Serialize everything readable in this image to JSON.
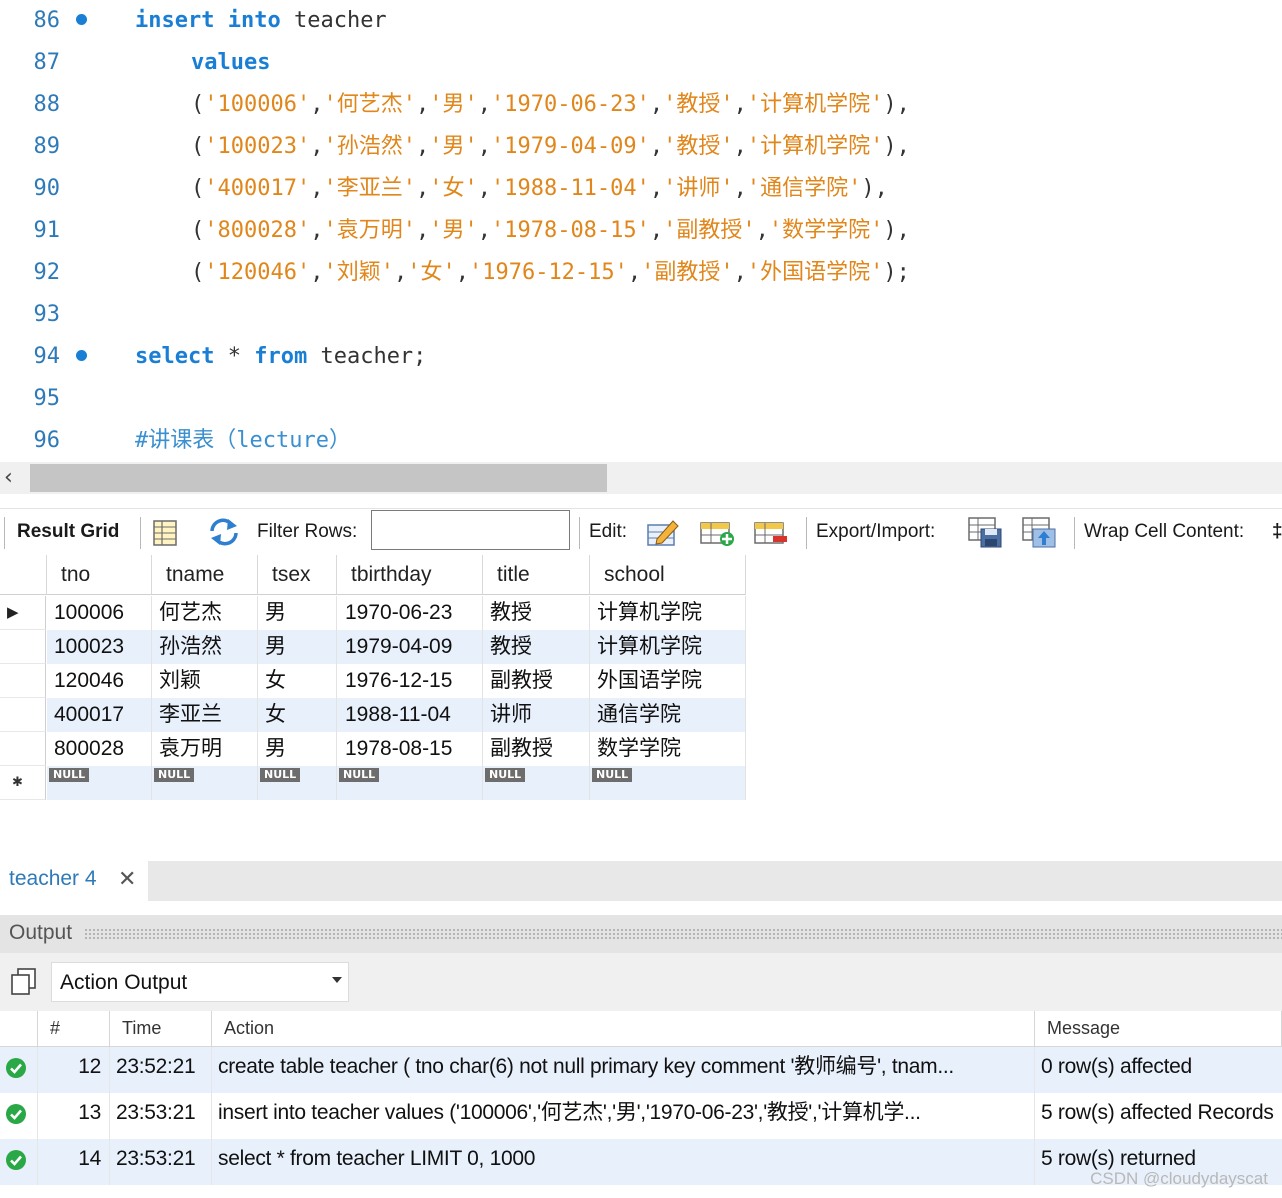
{
  "editor": {
    "lines": [
      {
        "num": "86",
        "marker": true,
        "tokens": [
          [
            "kw",
            "insert"
          ],
          [
            "id",
            " "
          ],
          [
            "kw",
            "into"
          ],
          [
            "id",
            " teacher"
          ]
        ],
        "indent": 0
      },
      {
        "num": "87",
        "marker": false,
        "tokens": [
          [
            "kw",
            "values"
          ]
        ],
        "indent": 1
      },
      {
        "num": "88",
        "marker": false,
        "tokens": [
          [
            "pun",
            "("
          ],
          [
            "str",
            "'100006'"
          ],
          [
            "pun",
            ","
          ],
          [
            "str",
            "'何艺杰'"
          ],
          [
            "pun",
            ","
          ],
          [
            "str",
            "'男'"
          ],
          [
            "pun",
            ","
          ],
          [
            "str",
            "'1970-06-23'"
          ],
          [
            "pun",
            ","
          ],
          [
            "str",
            "'教授'"
          ],
          [
            "pun",
            ","
          ],
          [
            "str",
            "'计算机学院'"
          ],
          [
            "pun",
            "),"
          ]
        ],
        "indent": 1
      },
      {
        "num": "89",
        "marker": false,
        "tokens": [
          [
            "pun",
            "("
          ],
          [
            "str",
            "'100023'"
          ],
          [
            "pun",
            ","
          ],
          [
            "str",
            "'孙浩然'"
          ],
          [
            "pun",
            ","
          ],
          [
            "str",
            "'男'"
          ],
          [
            "pun",
            ","
          ],
          [
            "str",
            "'1979-04-09'"
          ],
          [
            "pun",
            ","
          ],
          [
            "str",
            "'教授'"
          ],
          [
            "pun",
            ","
          ],
          [
            "str",
            "'计算机学院'"
          ],
          [
            "pun",
            "),"
          ]
        ],
        "indent": 1
      },
      {
        "num": "90",
        "marker": false,
        "tokens": [
          [
            "pun",
            "("
          ],
          [
            "str",
            "'400017'"
          ],
          [
            "pun",
            ","
          ],
          [
            "str",
            "'李亚兰'"
          ],
          [
            "pun",
            ","
          ],
          [
            "str",
            "'女'"
          ],
          [
            "pun",
            ","
          ],
          [
            "str",
            "'1988-11-04'"
          ],
          [
            "pun",
            ","
          ],
          [
            "str",
            "'讲师'"
          ],
          [
            "pun",
            ","
          ],
          [
            "str",
            "'通信学院'"
          ],
          [
            "pun",
            "),"
          ]
        ],
        "indent": 1
      },
      {
        "num": "91",
        "marker": false,
        "tokens": [
          [
            "pun",
            "("
          ],
          [
            "str",
            "'800028'"
          ],
          [
            "pun",
            ","
          ],
          [
            "str",
            "'袁万明'"
          ],
          [
            "pun",
            ","
          ],
          [
            "str",
            "'男'"
          ],
          [
            "pun",
            ","
          ],
          [
            "str",
            "'1978-08-15'"
          ],
          [
            "pun",
            ","
          ],
          [
            "str",
            "'副教授'"
          ],
          [
            "pun",
            ","
          ],
          [
            "str",
            "'数学学院'"
          ],
          [
            "pun",
            "),"
          ]
        ],
        "indent": 1
      },
      {
        "num": "92",
        "marker": false,
        "tokens": [
          [
            "pun",
            "("
          ],
          [
            "str",
            "'120046'"
          ],
          [
            "pun",
            ","
          ],
          [
            "str",
            "'刘颖'"
          ],
          [
            "pun",
            ","
          ],
          [
            "str",
            "'女'"
          ],
          [
            "pun",
            ","
          ],
          [
            "str",
            "'1976-12-15'"
          ],
          [
            "pun",
            ","
          ],
          [
            "str",
            "'副教授'"
          ],
          [
            "pun",
            ","
          ],
          [
            "str",
            "'外国语学院'"
          ],
          [
            "pun",
            ");"
          ]
        ],
        "indent": 1
      },
      {
        "num": "93",
        "marker": false,
        "tokens": [],
        "indent": 0
      },
      {
        "num": "94",
        "marker": true,
        "tokens": [
          [
            "kw",
            "select"
          ],
          [
            "id",
            " * "
          ],
          [
            "kw",
            "from"
          ],
          [
            "id",
            " teacher;"
          ]
        ],
        "indent": 0
      },
      {
        "num": "95",
        "marker": false,
        "tokens": [],
        "indent": 0
      },
      {
        "num": "96",
        "marker": false,
        "tokens": [
          [
            "cmt",
            "#讲课表（lecture）"
          ]
        ],
        "indent": 0
      }
    ]
  },
  "result_toolbar": {
    "result_grid_label": "Result Grid",
    "filter_rows_label": "Filter Rows:",
    "filter_rows_value": "",
    "edit_label": "Edit:",
    "export_import_label": "Export/Import:",
    "wrap_cell_label": "Wrap Cell Content:",
    "trailing_glyph": "‡"
  },
  "result_grid": {
    "columns": [
      "tno",
      "tname",
      "tsex",
      "tbirthday",
      "title",
      "school"
    ],
    "rows": [
      [
        "100006",
        "何艺杰",
        "男",
        "1970-06-23",
        "教授",
        "计算机学院"
      ],
      [
        "100023",
        "孙浩然",
        "男",
        "1979-04-09",
        "教授",
        "计算机学院"
      ],
      [
        "120046",
        "刘颖",
        "女",
        "1976-12-15",
        "副教授",
        "外国语学院"
      ],
      [
        "400017",
        "李亚兰",
        "女",
        "1988-11-04",
        "讲师",
        "通信学院"
      ],
      [
        "800028",
        "袁万明",
        "男",
        "1978-08-15",
        "副教授",
        "数学学院"
      ]
    ],
    "null_label": "NULL",
    "current_row_marker": "▶",
    "new_row_marker": "✱"
  },
  "result_tab": {
    "label": "teacher 4",
    "close": "✕"
  },
  "output": {
    "title": "Output",
    "select_value": "Action Output",
    "columns": [
      "#",
      "Time",
      "Action",
      "Message"
    ],
    "rows": [
      {
        "num": "12",
        "time": "23:52:21",
        "action": "create table teacher ( tno char(6) not null primary key comment '教师编号',     tnam...",
        "message": "0 row(s) affected"
      },
      {
        "num": "13",
        "time": "23:53:21",
        "action": "insert into teacher values     ('100006','何艺杰','男','1970-06-23','教授','计算机学...",
        "message": "5 row(s) affected Records"
      },
      {
        "num": "14",
        "time": "23:53:21",
        "action": "select * from teacher LIMIT 0, 1000",
        "message": "5 row(s) returned"
      }
    ]
  },
  "watermark": "CSDN @cloudydayscat",
  "colors": {
    "keyword": "#1a7fd4",
    "string": "#e0861a",
    "line_number": "#2e7ab8",
    "alt_row": "#e8f0fb",
    "ok_green": "#2aa847"
  }
}
